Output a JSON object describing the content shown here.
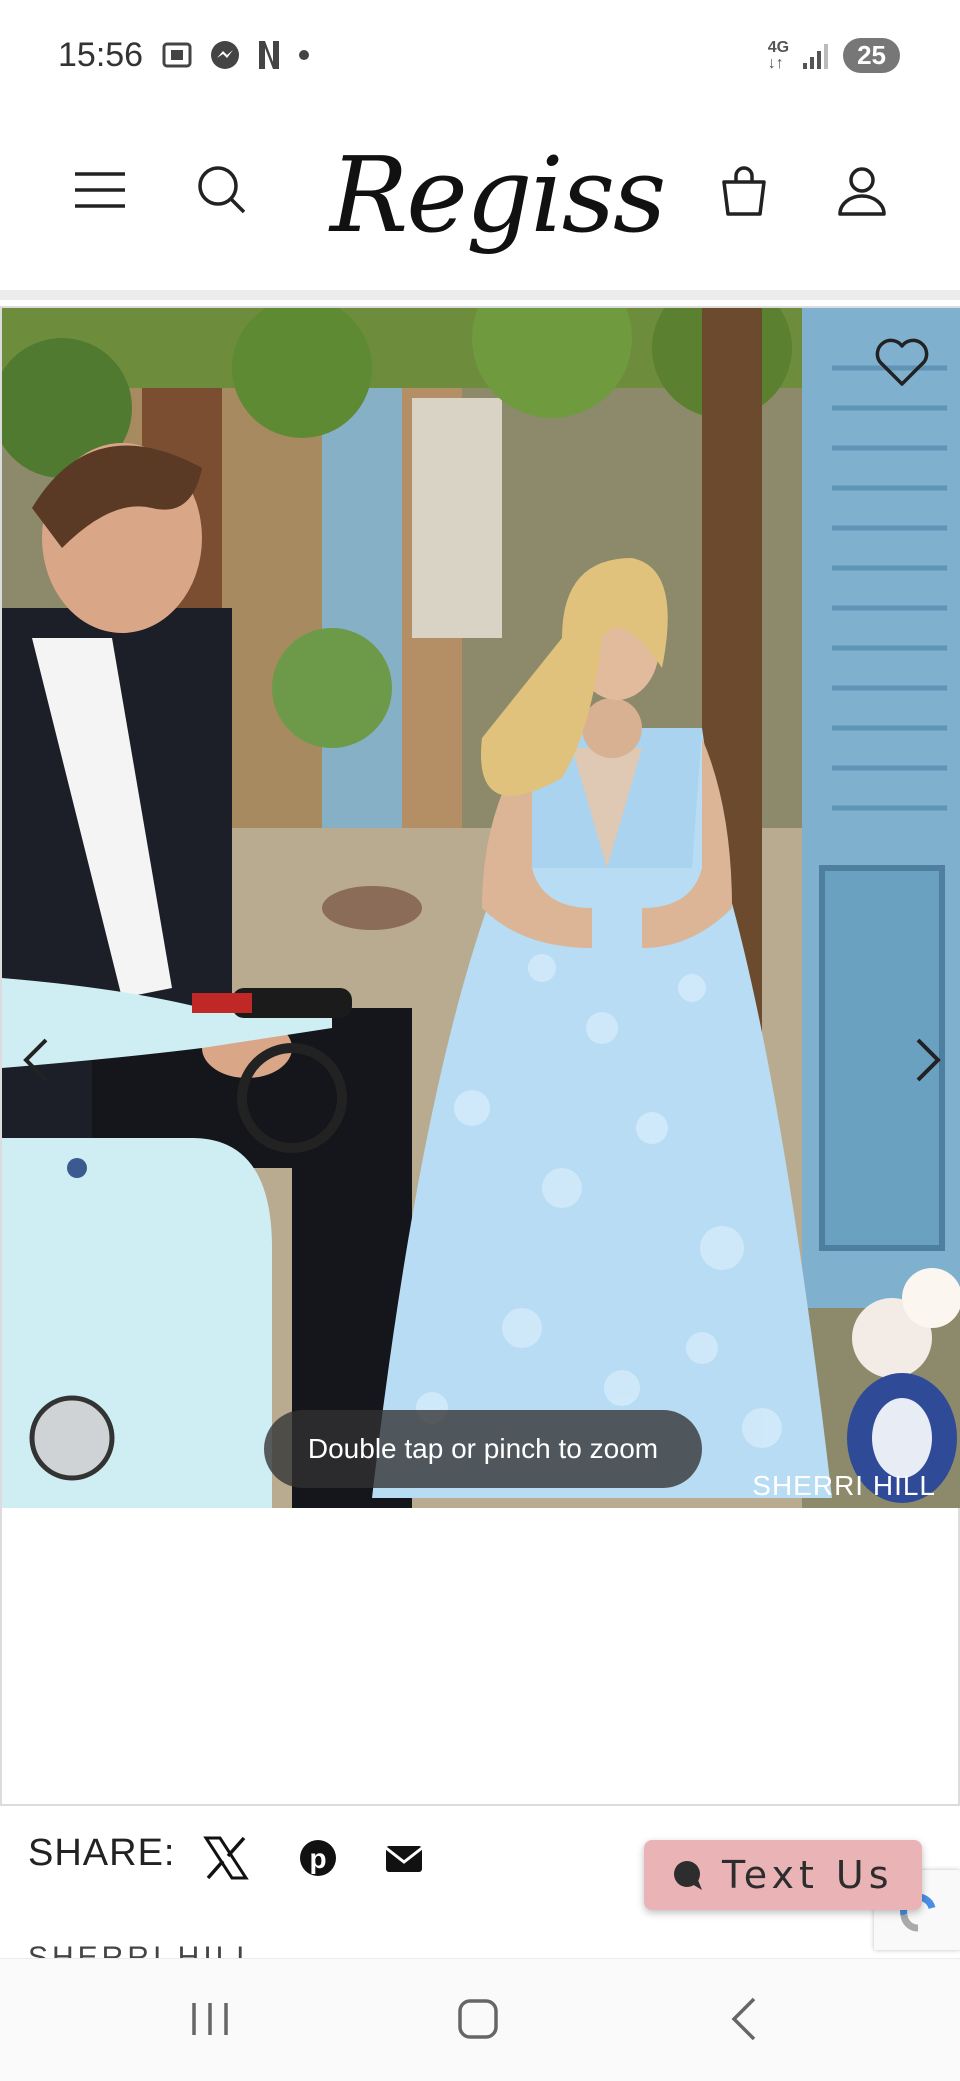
{
  "status_bar": {
    "time": "15:56",
    "network": "4G",
    "battery": "25",
    "icons": [
      "screenshot-icon",
      "messenger-icon",
      "netflix-icon",
      "dot-icon",
      "signal-icon"
    ]
  },
  "header": {
    "logo_text": "Regiss",
    "icons": [
      "menu-icon",
      "search-icon",
      "shopping-bag-icon",
      "account-icon"
    ]
  },
  "gallery": {
    "zoom_hint": "Double tap or pinch to zoom",
    "watermark": "SHERRI HILL",
    "icons": [
      "wishlist-heart-icon",
      "chevron-left-icon",
      "chevron-right-icon"
    ]
  },
  "share": {
    "label": "SHARE:",
    "icons": [
      "x-twitter-icon",
      "pinterest-icon",
      "email-icon"
    ]
  },
  "text_us": {
    "label": "Text Us",
    "icon": "chat-bubble-icon"
  },
  "brand_peek": "SHERRI HILL",
  "system_nav": {
    "icons": [
      "recent-apps-icon",
      "home-icon",
      "back-icon"
    ]
  },
  "colors": {
    "text_us_bg": "#eab4b6",
    "dress": "#b7dcf3",
    "scooter": "#cfeef4"
  }
}
